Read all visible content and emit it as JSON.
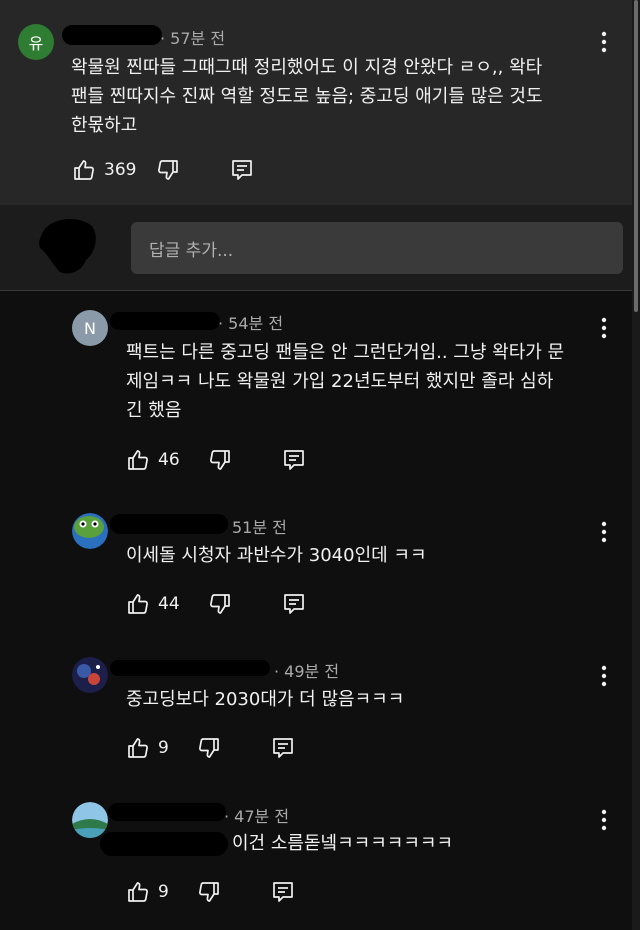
{
  "top_comment": {
    "avatar_letter": "유",
    "avatar_color": "#2e7d32",
    "time": "· 57분 전",
    "text": "왁물원 찐따들 그때그때 정리했어도 이 지경 안왔다 ㄹㅇ,, 왁타\n팬들 찐따지수 진짜 역할 정도로 높음; 중고딩 애기들 많은 것도\n한몫하고",
    "likes": "369"
  },
  "reply_input": {
    "placeholder": "답글 추가..."
  },
  "replies": [
    {
      "avatar_letter": "N",
      "avatar_color": "#8a9aa8",
      "time": "· 54분 전",
      "text": "팩트는 다른 중고딩 팬들은 안 그런단거임.. 그냥 왁타가 문\n제임ㅋㅋ 나도 왁물원 가입 22년도부터 했지만 졸라 심하\n긴 했음",
      "likes": "46"
    },
    {
      "time": "51분 전",
      "text": "이세돌 시청자 과반수가 3040인데 ㅋㅋ",
      "likes": "44"
    },
    {
      "time": "· 49분 전",
      "text": "중고딩보다 2030대가 더 많음ㅋㅋㅋ",
      "likes": "9"
    },
    {
      "time": "· 47분 전",
      "text": "이건 소름돋넼ㅋㅋㅋㅋㅋㅋㅋ",
      "likes": "9"
    }
  ],
  "icons": {
    "like": "thumbs-up-icon",
    "dislike": "thumbs-down-icon",
    "reply": "reply-icon",
    "more": "more-vert-icon"
  }
}
